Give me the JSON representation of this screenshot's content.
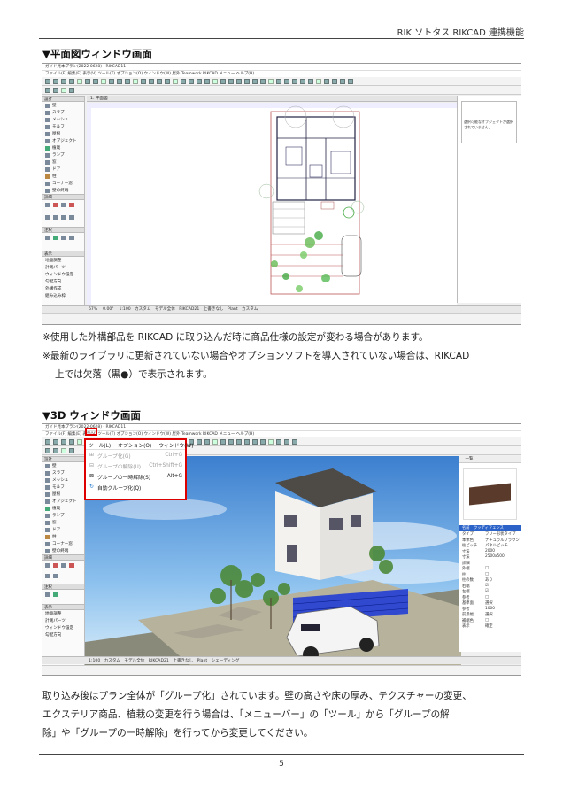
{
  "header": {
    "title": "RIK ソトタス RIKCAD 連携機能"
  },
  "section1": {
    "heading": "▼平面図ウィンドウ画面",
    "screenshot": {
      "titlebar": "ガイド見本プラン(2022-0628) - RIKCAD11",
      "menubar": "ファイル(F)  編集(E)  表示(V)  ツール(T)  オプション(O)  ウィンドウ(W)  屋外  Teamwork  RIKCAD  メニュー  ヘルプ(H)",
      "tab_label": "1. 平面図",
      "note": "選択可能なオブジェクトが選択されていません。",
      "tools": [
        "壁",
        "スラブ",
        "メッシュ",
        "モルフ",
        "屋根",
        "オブジェクト",
        "植栽",
        "ランプ",
        "窓",
        "ドア",
        "柱",
        "コーナー窓",
        "壁の終端"
      ],
      "sections": [
        "詳細",
        "注釈",
        "表示"
      ],
      "navigator": [
        "地盤調整",
        "計測パーツ",
        "ウィンドウ設定",
        "勾配方向",
        "外構作成",
        "組み込み枠",
        "配置リスト",
        "植栽",
        "機能設定"
      ],
      "statusbar": [
        "1:100",
        "カスタム",
        "モデル全体",
        "RIKCAD21",
        "上書きなし",
        "Plant",
        "カスタム"
      ],
      "zoom": "67%",
      "angle": "0.00°"
    }
  },
  "notes1": [
    "※使用した外構部品を RIKCAD に取り込んだ時に商品仕様の設定が変わる場合があります。",
    "※最新のライブラリに更新されていない場合やオプションソフトを導入されていない場合は、RIKCAD",
    "上では欠落（黒●）で表示されます。"
  ],
  "section2": {
    "heading": "▼3D ウィンドウ画面",
    "screenshot": {
      "titlebar": "ガイド見本プラン(2022-0628) - RIKCAD11",
      "menubar": "ファイル(F)  編集(E)  表示(V)  ツール(T)  オプション(O)  ウィンドウ(W)  屋外  Teamwork  RIKCAD  メニュー  ヘルプ(H)",
      "context_menu": {
        "menus": [
          "ツール(L)",
          "オプション(O)",
          "ウィンドウ(W)"
        ],
        "items": [
          {
            "label": "グループ化(G)",
            "shortcut": "Ctrl+G",
            "enabled": false
          },
          {
            "label": "グループの解除(U)",
            "shortcut": "Ctrl+Shift+G",
            "enabled": false
          },
          {
            "label": "グループの一時解除(S)",
            "shortcut": "Alt+G",
            "enabled": true
          },
          {
            "label": "自動グループ化(Q)",
            "shortcut": "",
            "enabled": true
          }
        ]
      },
      "props": [
        [
          "名前",
          "ウッディフェンス"
        ],
        [
          "タイプ",
          "フリー形状タイプ"
        ],
        [
          "本体色",
          "ナチュラルブラウン"
        ],
        [
          "柱ピッチ",
          "パネルピッチ"
        ],
        [
          "寸法",
          "2000"
        ],
        [
          "寸法",
          "2500x500"
        ],
        [
          "詳細",
          ""
        ],
        [
          "外端",
          "□"
        ],
        [
          "柱",
          "□"
        ],
        [
          "柱の数",
          "あり"
        ],
        [
          "右端",
          "☑"
        ],
        [
          "左端",
          "☑"
        ],
        [
          "参考",
          "□"
        ],
        [
          "基準面",
          "選択"
        ],
        [
          "参考",
          "1000"
        ],
        [
          "前景幅",
          "選択"
        ],
        [
          "補端色",
          "□"
        ],
        [
          "表示",
          "確定"
        ]
      ],
      "statusbar": [
        "1:100",
        "カスタム",
        "モデル全体",
        "RIKCAD21",
        "上書きなし",
        "Plant",
        "シェーディング"
      ]
    }
  },
  "notes2": [
    "取り込み後はプラン全体が「グループ化」されています。壁の高さや床の厚み、テクスチャーの変更、",
    "エクステリア商品、植栽の変更を行う場合は、「メニューバー」の「ツール」から「グループの解",
    "除」や「グループの一時解除」を行ってから変更してください。"
  ],
  "footer": {
    "page": "5"
  },
  "colors": {
    "highlight": "#dd0000",
    "sky": "#5b9bd5",
    "fence": "#1a36d8"
  }
}
